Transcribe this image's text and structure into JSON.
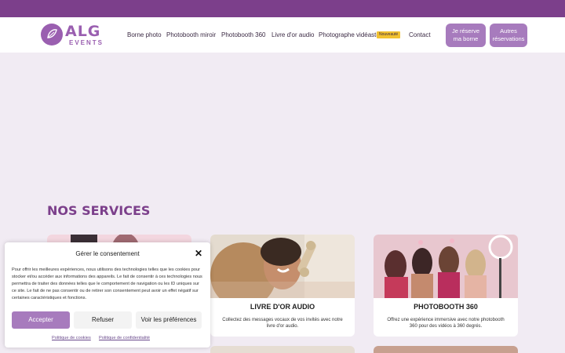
{
  "header": {
    "logo_main": "ALG",
    "logo_sub": "EVENTS",
    "nav": [
      {
        "label": "Borne photo"
      },
      {
        "label": "Photobooth miroir"
      },
      {
        "label": "Photobooth 360"
      },
      {
        "label": "Livre d'or audio"
      },
      {
        "label": "Photographe vidéaste"
      },
      {
        "label": "Contact"
      }
    ],
    "nav_badge": "Nouveauté",
    "cta_reserve": "Je réserve ma borne",
    "cta_other": "Autres réservations"
  },
  "services": {
    "title": "NOS SERVICES",
    "cards": [
      {
        "title": "",
        "desc": ""
      },
      {
        "title": "LIVRE D'OR AUDIO",
        "desc": "Collectez des messages vocaux de vos invités avec notre livre d'or audio."
      },
      {
        "title": "PHOTOBOOTH 360",
        "desc": "Offrez une expérience immersive avec notre photobooth 360 pour des vidéos à 360 degrés."
      }
    ]
  },
  "consent": {
    "title": "Gérer le consentement",
    "text": "Pour offrir les meilleures expériences, nous utilisons des technologies telles que les cookies pour stocker et/ou accéder aux informations des appareils. Le fait de consentir à ces technologies nous permettra de traiter des données telles que le comportement de navigation ou les ID uniques sur ce site. Le fait de ne pas consentir ou de retirer son consentement peut avoir un effet négatif sur certaines caractéristiques et fonctions.",
    "accept": "Accepter",
    "refuse": "Refuser",
    "prefs": "Voir les préférences",
    "link_cookies": "Politique de cookies",
    "link_privacy": "Politique de confidentialité"
  },
  "colors": {
    "brand_purple": "#7c3f8b",
    "accent_lilac": "#a77bbd",
    "page_bg": "#f1ebf3",
    "badge_yellow": "#f2c230"
  }
}
